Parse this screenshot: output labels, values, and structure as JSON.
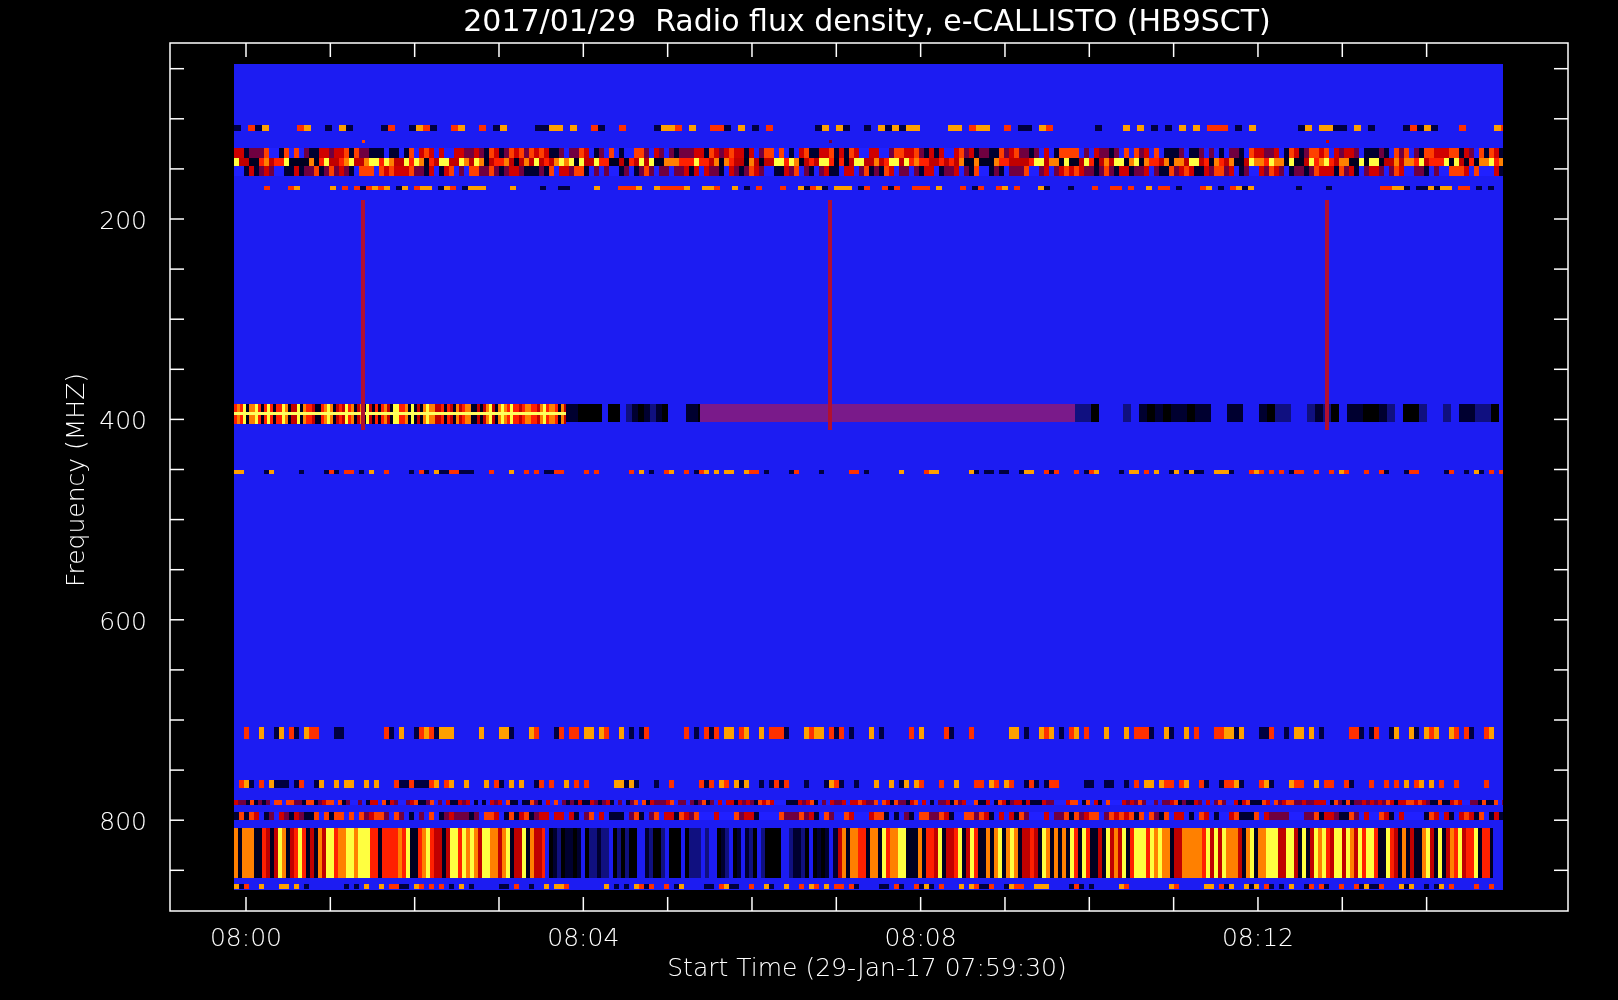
{
  "chart": {
    "title": "2017/01/29  Radio flux density, e-CALLISTO (HB9SCT)",
    "xlabel": "Start Time (29-Jan-17 07:59:30)",
    "ylabel": "Frequency (MHZ)",
    "xticks": [
      "08:00",
      "08:04",
      "08:08",
      "08:12"
    ],
    "yticks": [
      "200",
      "400",
      "600",
      "800"
    ]
  }
}
